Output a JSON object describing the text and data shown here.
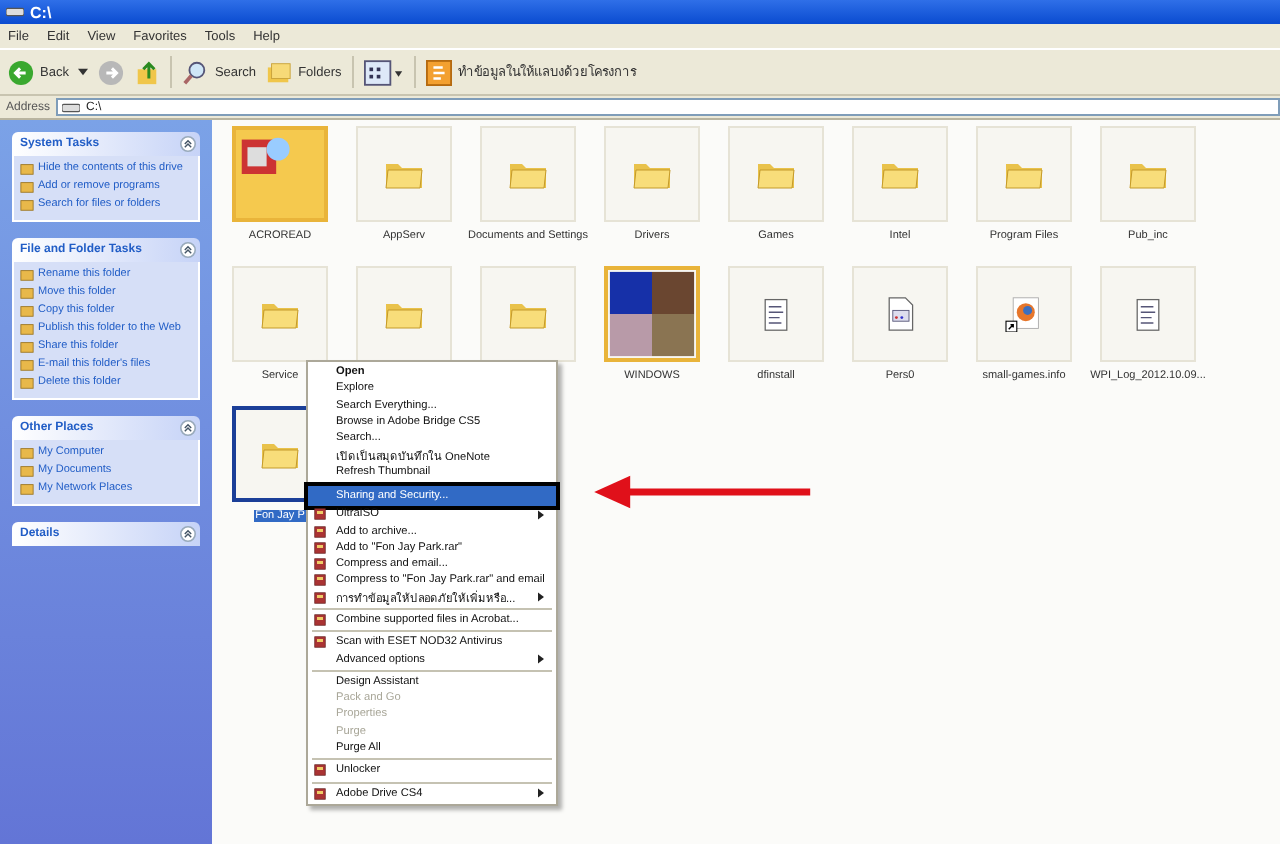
{
  "window": {
    "title": "C:\\"
  },
  "menu_bar": [
    "File",
    "Edit",
    "View",
    "Favorites",
    "Tools",
    "Help"
  ],
  "toolbar": {
    "back": "Back",
    "search": "Search",
    "folders": "Folders",
    "custom_button": "ทำข้อมูลในให้แลบงด้วยโครงการ"
  },
  "address_bar": {
    "label": "Address",
    "value": "C:\\"
  },
  "sidebar": {
    "panels": [
      {
        "title": "System Tasks",
        "items": [
          "Hide the contents of this drive",
          "Add or remove programs",
          "Search for files or folders"
        ]
      },
      {
        "title": "File and Folder Tasks",
        "items": [
          "Rename this folder",
          "Move this folder",
          "Copy this folder",
          "Publish this folder to the Web",
          "Share this folder",
          "E-mail this folder's files",
          "Delete this folder"
        ]
      },
      {
        "title": "Other Places",
        "items": [
          "My Computer",
          "My Documents",
          "My Network Places"
        ]
      },
      {
        "title": "Details"
      }
    ]
  },
  "files": [
    {
      "label": "ACROREAD",
      "kind": "thumb-folder",
      "selected": false
    },
    {
      "label": "AppServ",
      "kind": "folder",
      "selected": false
    },
    {
      "label": "Documents and Settings",
      "kind": "folder",
      "selected": false
    },
    {
      "label": "Drivers",
      "kind": "folder",
      "selected": false
    },
    {
      "label": "Games",
      "kind": "folder",
      "selected": false
    },
    {
      "label": "Intel",
      "kind": "folder",
      "selected": false
    },
    {
      "label": "Program Files",
      "kind": "folder",
      "selected": false
    },
    {
      "label": "Pub_inc",
      "kind": "folder",
      "selected": false
    },
    {
      "label": "Service",
      "kind": "folder",
      "selected": false
    },
    {
      "kind": "folder",
      "selected": false
    },
    {
      "kind": "folder",
      "selected": false
    },
    {
      "label": "WINDOWS",
      "kind": "picture-folder",
      "selected": false
    },
    {
      "label": "dfinstall",
      "kind": "text-file",
      "selected": false
    },
    {
      "label": "Pers0",
      "kind": "app-file",
      "selected": false
    },
    {
      "label": "small-games.info",
      "kind": "browser-shortcut",
      "selected": false
    },
    {
      "label": "WPI_Log_2012.10.09...",
      "kind": "text-file",
      "selected": false
    },
    {
      "label": "Fon Jay P",
      "kind": "folder",
      "selected": true
    }
  ],
  "context_menu": [
    {
      "kind": "item",
      "label": "Open",
      "bold": true,
      "icon": false,
      "disabled": false,
      "submenu": false,
      "selected": false
    },
    {
      "kind": "item",
      "label": "Explore",
      "bold": false,
      "icon": false,
      "disabled": false,
      "submenu": false,
      "selected": false
    },
    {
      "kind": "item",
      "label": "Search Everything...",
      "bold": false,
      "icon": false,
      "disabled": false,
      "submenu": false,
      "selected": false
    },
    {
      "kind": "item",
      "label": "Browse in Adobe Bridge CS5",
      "bold": false,
      "icon": false,
      "disabled": false,
      "submenu": false,
      "selected": false
    },
    {
      "kind": "item",
      "label": "Search...",
      "bold": false,
      "icon": false,
      "disabled": false,
      "submenu": false,
      "selected": false
    },
    {
      "kind": "item",
      "label": "เปิดเป็นสมุดบันทึกใน OneNote",
      "bold": false,
      "icon": false,
      "disabled": false,
      "submenu": false,
      "selected": false
    },
    {
      "kind": "item",
      "label": "Refresh Thumbnail",
      "bold": false,
      "icon": false,
      "disabled": false,
      "submenu": false,
      "selected": false
    },
    {
      "kind": "separator"
    },
    {
      "kind": "item",
      "label": "Sharing and Security...",
      "bold": false,
      "icon": false,
      "disabled": false,
      "submenu": false,
      "selected": true
    },
    {
      "kind": "item",
      "label": "UltraISO",
      "bold": false,
      "icon": true,
      "disabled": false,
      "submenu": true,
      "selected": false
    },
    {
      "kind": "item",
      "label": "Add to archive...",
      "bold": false,
      "icon": true,
      "disabled": false,
      "submenu": false,
      "selected": false
    },
    {
      "kind": "item",
      "label": "Add to \"Fon Jay Park.rar\"",
      "bold": false,
      "icon": true,
      "disabled": false,
      "submenu": false,
      "selected": false
    },
    {
      "kind": "item",
      "label": "Compress and email...",
      "bold": false,
      "icon": true,
      "disabled": false,
      "submenu": false,
      "selected": false
    },
    {
      "kind": "item",
      "label": "Compress to \"Fon Jay Park.rar\" and email",
      "bold": false,
      "icon": true,
      "disabled": false,
      "submenu": false,
      "selected": false
    },
    {
      "kind": "item",
      "label": "การทำข้อมูลให้ปลอดภัยให้เพิ่มหรือ...",
      "bold": false,
      "icon": true,
      "disabled": false,
      "submenu": true,
      "selected": false
    },
    {
      "kind": "separator"
    },
    {
      "kind": "item",
      "label": "Combine supported files in Acrobat...",
      "bold": false,
      "icon": true,
      "disabled": false,
      "submenu": false,
      "selected": false
    },
    {
      "kind": "separator"
    },
    {
      "kind": "item",
      "label": "Scan with ESET NOD32 Antivirus",
      "bold": false,
      "icon": true,
      "disabled": false,
      "submenu": false,
      "selected": false
    },
    {
      "kind": "item",
      "label": "Advanced options",
      "bold": false,
      "icon": false,
      "disabled": false,
      "submenu": true,
      "selected": false
    },
    {
      "kind": "separator"
    },
    {
      "kind": "item",
      "label": "Design Assistant",
      "bold": false,
      "icon": false,
      "disabled": false,
      "submenu": false,
      "selected": false
    },
    {
      "kind": "item",
      "label": "Pack and Go",
      "bold": false,
      "icon": false,
      "disabled": true,
      "submenu": false,
      "selected": false
    },
    {
      "kind": "item",
      "label": "Properties",
      "bold": false,
      "icon": false,
      "disabled": true,
      "submenu": false,
      "selected": false
    },
    {
      "kind": "item",
      "label": "Purge",
      "bold": false,
      "icon": false,
      "disabled": true,
      "submenu": false,
      "selected": false
    },
    {
      "kind": "item",
      "label": "Purge All",
      "bold": false,
      "icon": false,
      "disabled": false,
      "submenu": false,
      "selected": false
    },
    {
      "kind": "separator"
    },
    {
      "kind": "item",
      "label": "Unlocker",
      "bold": false,
      "icon": true,
      "disabled": false,
      "submenu": false,
      "selected": false
    },
    {
      "kind": "separator"
    },
    {
      "kind": "item",
      "label": "Adobe Drive CS4",
      "bold": false,
      "icon": true,
      "disabled": false,
      "submenu": true,
      "selected": false
    }
  ]
}
